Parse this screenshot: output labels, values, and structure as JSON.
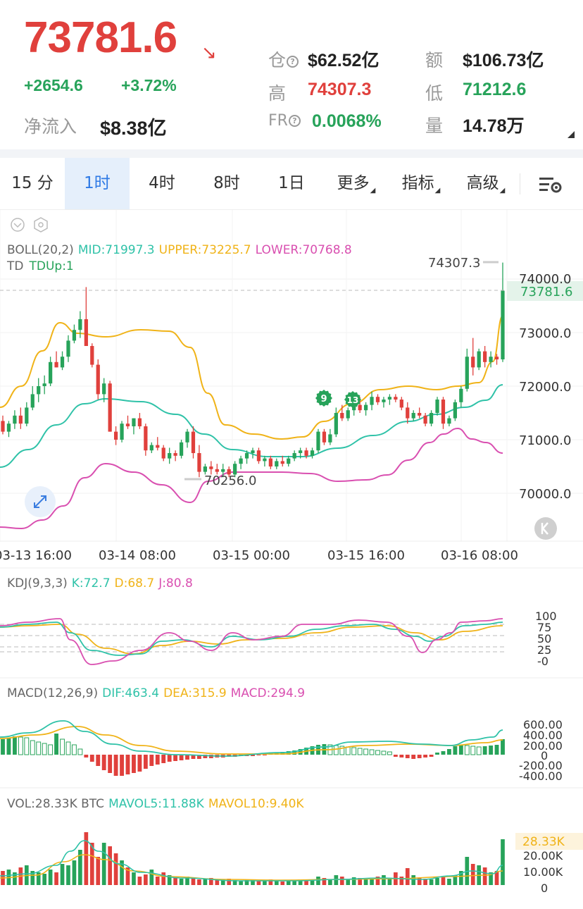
{
  "header": {
    "price": "73781.6",
    "price_arrow": "↘",
    "change_abs": "+2654.6",
    "change_pct": "+3.72%",
    "net_inflow_label": "净流入",
    "net_inflow_value": "$8.38亿",
    "open_interest_label": "仓",
    "open_interest_value": "$62.52亿",
    "turnover_label": "额",
    "turnover_value": "$106.73亿",
    "high_label": "高",
    "high_value": "74307.3",
    "low_label": "低",
    "low_value": "71212.6",
    "fr_label": "FR",
    "fr_value": "0.0068%",
    "volume_label": "量",
    "volume_value": "14.78万",
    "help_glyph": "?"
  },
  "tabs": [
    {
      "label": "15 分",
      "active": false
    },
    {
      "label": "1时",
      "active": true
    },
    {
      "label": "4时",
      "active": false
    },
    {
      "label": "8时",
      "active": false
    },
    {
      "label": "1日",
      "active": false
    },
    {
      "label": "更多",
      "active": false,
      "dropdown": true
    },
    {
      "label": "指标",
      "active": false,
      "dropdown": true
    },
    {
      "label": "高级",
      "active": false,
      "dropdown": true
    }
  ],
  "icons": {
    "settings": "chart-settings-icon",
    "expand": "expand-icon",
    "collapse": "collapse-icon",
    "eye": "eye-icon",
    "hex": "hexagon-settings-icon",
    "scroll_back": "scroll-to-latest-icon"
  },
  "colors": {
    "up": "#27a35a",
    "down": "#e0403c",
    "mid": "#2fc2a8",
    "upper": "#f0b318",
    "lower": "#d94fb0",
    "tab_active_bg": "#e5effb",
    "tab_active_text": "#2f7ae5"
  },
  "main_chart": {
    "boll_label": "BOLL(20,2)",
    "mid_label": "MID:71997.3",
    "upper_label": "UPPER:73225.7",
    "lower_label": "LOWER:70768.8",
    "td_label": "TD",
    "td_up_label": "TDUp:1",
    "high_marker": "74307.3",
    "low_marker": "70256.0",
    "last_price_tag": "73781.6",
    "td_badges": [
      "9",
      "13"
    ],
    "y_ticks": [
      "74000.0",
      "73000.0",
      "72000.0",
      "71000.0",
      "70000.0"
    ],
    "x_ticks": [
      "03-13 16:00",
      "03-14 08:00",
      "03-15 00:00",
      "03-15 16:00",
      "03-16 08:00"
    ]
  },
  "kdj": {
    "label": "KDJ(9,3,3)",
    "k_label": "K:72.7",
    "d_label": "D:68.7",
    "j_label": "J:80.8",
    "y_ticks": [
      "100",
      "75",
      "50",
      "25",
      "-0"
    ]
  },
  "macd": {
    "label": "MACD(12,26,9)",
    "dif_label": "DIF:463.4",
    "dea_label": "DEA:315.9",
    "macd_label": "MACD:294.9",
    "y_ticks": [
      "600.00",
      "400.00",
      "200.00",
      "0",
      "-200.00",
      "-400.00"
    ]
  },
  "volume": {
    "label": "VOL:28.33K BTC",
    "mavol5_label": "MAVOL5:11.88K",
    "mavol10_label": "MAVOL10:9.40K",
    "last_tag": "28.33K",
    "y_ticks": [
      "20.00K",
      "10.00K",
      "0"
    ]
  },
  "chart_data": {
    "type": "candlestick",
    "interval": "1时",
    "x_range": [
      "03-13 16:00",
      "03-16 09:00"
    ],
    "ylim": [
      69500,
      74500
    ],
    "candles_ohlc": [
      [
        71350,
        71450,
        71100,
        71150
      ],
      [
        71150,
        71350,
        71050,
        71300
      ],
      [
        71300,
        71550,
        71200,
        71450
      ],
      [
        71450,
        71600,
        71200,
        71300
      ],
      [
        71300,
        71700,
        71250,
        71600
      ],
      [
        71600,
        72000,
        71550,
        71850
      ],
      [
        71850,
        72150,
        71700,
        72000
      ],
      [
        72000,
        72200,
        71850,
        72050
      ],
      [
        72050,
        72550,
        72000,
        72450
      ],
      [
        72450,
        72650,
        72350,
        72350
      ],
      [
        72350,
        72650,
        72300,
        72550
      ],
      [
        72550,
        72950,
        72450,
        72850
      ],
      [
        72850,
        73150,
        72800,
        73050
      ],
      [
        73050,
        73400,
        72900,
        73250
      ],
      [
        73250,
        73850,
        72750,
        72750
      ],
      [
        72750,
        72800,
        72350,
        72400
      ],
      [
        72400,
        72500,
        71750,
        71850
      ],
      [
        71850,
        72150,
        71700,
        72050
      ],
      [
        72050,
        72100,
        71150,
        71150
      ],
      [
        71150,
        71250,
        70900,
        71000
      ],
      [
        71000,
        71350,
        70950,
        71300
      ],
      [
        71300,
        71450,
        71200,
        71250
      ],
      [
        71250,
        71400,
        71100,
        71400
      ],
      [
        71400,
        71500,
        71200,
        71250
      ],
      [
        71250,
        71300,
        70700,
        70800
      ],
      [
        70800,
        70950,
        70750,
        70900
      ],
      [
        70900,
        71050,
        70800,
        70850
      ],
      [
        70850,
        70900,
        70600,
        70650
      ],
      [
        70650,
        70850,
        70550,
        70750
      ],
      [
        70750,
        70800,
        70600,
        70700
      ],
      [
        70700,
        71000,
        70650,
        70950
      ],
      [
        70950,
        71200,
        70850,
        71150
      ],
      [
        71150,
        71250,
        70650,
        70750
      ],
      [
        70750,
        70900,
        70300,
        70400
      ],
      [
        70400,
        70550,
        70350,
        70500
      ],
      [
        70500,
        70600,
        70350,
        70450
      ],
      [
        70450,
        70550,
        70350,
        70400
      ],
      [
        70400,
        70550,
        70300,
        70450
      ],
      [
        70450,
        70500,
        70300,
        70350
      ],
      [
        70350,
        70600,
        70300,
        70550
      ],
      [
        70550,
        70700,
        70450,
        70650
      ],
      [
        70650,
        70800,
        70550,
        70750
      ],
      [
        70750,
        70850,
        70650,
        70800
      ],
      [
        70800,
        70850,
        70550,
        70600
      ],
      [
        70600,
        70700,
        70500,
        70650
      ],
      [
        70650,
        70700,
        70450,
        70500
      ],
      [
        70500,
        70650,
        70450,
        70600
      ],
      [
        70600,
        70700,
        70500,
        70550
      ],
      [
        70550,
        70700,
        70500,
        70650
      ],
      [
        70650,
        70800,
        70600,
        70750
      ],
      [
        70750,
        70850,
        70650,
        70800
      ],
      [
        70800,
        70850,
        70650,
        70700
      ],
      [
        70700,
        70850,
        70650,
        70800
      ],
      [
        70800,
        71200,
        70750,
        71150
      ],
      [
        71150,
        71200,
        70900,
        70950
      ],
      [
        70950,
        71200,
        70900,
        71100
      ],
      [
        71100,
        71600,
        71050,
        71500
      ],
      [
        71500,
        71650,
        71350,
        71400
      ],
      [
        71400,
        71600,
        71350,
        71550
      ],
      [
        71550,
        71750,
        71450,
        71650
      ],
      [
        71650,
        71800,
        71500,
        71550
      ],
      [
        71550,
        71700,
        71450,
        71650
      ],
      [
        71650,
        71900,
        71550,
        71800
      ],
      [
        71800,
        71850,
        71650,
        71700
      ],
      [
        71700,
        71800,
        71600,
        71750
      ],
      [
        71750,
        71850,
        71650,
        71800
      ],
      [
        71800,
        71850,
        71700,
        71750
      ],
      [
        71750,
        71800,
        71550,
        71600
      ],
      [
        71600,
        71700,
        71300,
        71400
      ],
      [
        71400,
        71550,
        71350,
        71500
      ],
      [
        71500,
        71600,
        71400,
        71450
      ],
      [
        71450,
        71500,
        71250,
        71300
      ],
      [
        71300,
        71550,
        71250,
        71500
      ],
      [
        71500,
        71800,
        71450,
        71750
      ],
      [
        71750,
        71800,
        71200,
        71300
      ],
      [
        71300,
        71450,
        71250,
        71400
      ],
      [
        71400,
        71750,
        71350,
        71700
      ],
      [
        71700,
        72000,
        71600,
        71950
      ],
      [
        71950,
        72700,
        71900,
        72550
      ],
      [
        72550,
        72900,
        72200,
        72350
      ],
      [
        72350,
        72700,
        72300,
        72650
      ],
      [
        72650,
        72750,
        72350,
        72450
      ],
      [
        72450,
        72650,
        72350,
        72550
      ],
      [
        72550,
        72600,
        72400,
        72500
      ],
      [
        72500,
        74307,
        72450,
        73781.6
      ]
    ],
    "boll_mid_approx": [
      70600,
      70800,
      71000,
      71150,
      71250,
      71350,
      71400,
      71450,
      71450,
      71400,
      71350,
      71300,
      71200,
      71100,
      71000,
      70950,
      70850,
      70800,
      70750,
      70700,
      70700,
      70750,
      70800,
      70900,
      71000,
      71100,
      71200,
      71300,
      71400,
      71500,
      71600,
      71700,
      71800,
      71900,
      72000
    ],
    "kdj_series": {
      "K": 72.7,
      "D": 68.7,
      "J": 80.8
    },
    "macd_series": {
      "DIF": 463.4,
      "DEA": 315.9,
      "MACD": 294.9
    },
    "volume_series": {
      "VOL": "28.33K",
      "MAVOL5": "11.88K",
      "MAVOL10": "9.40K"
    }
  }
}
